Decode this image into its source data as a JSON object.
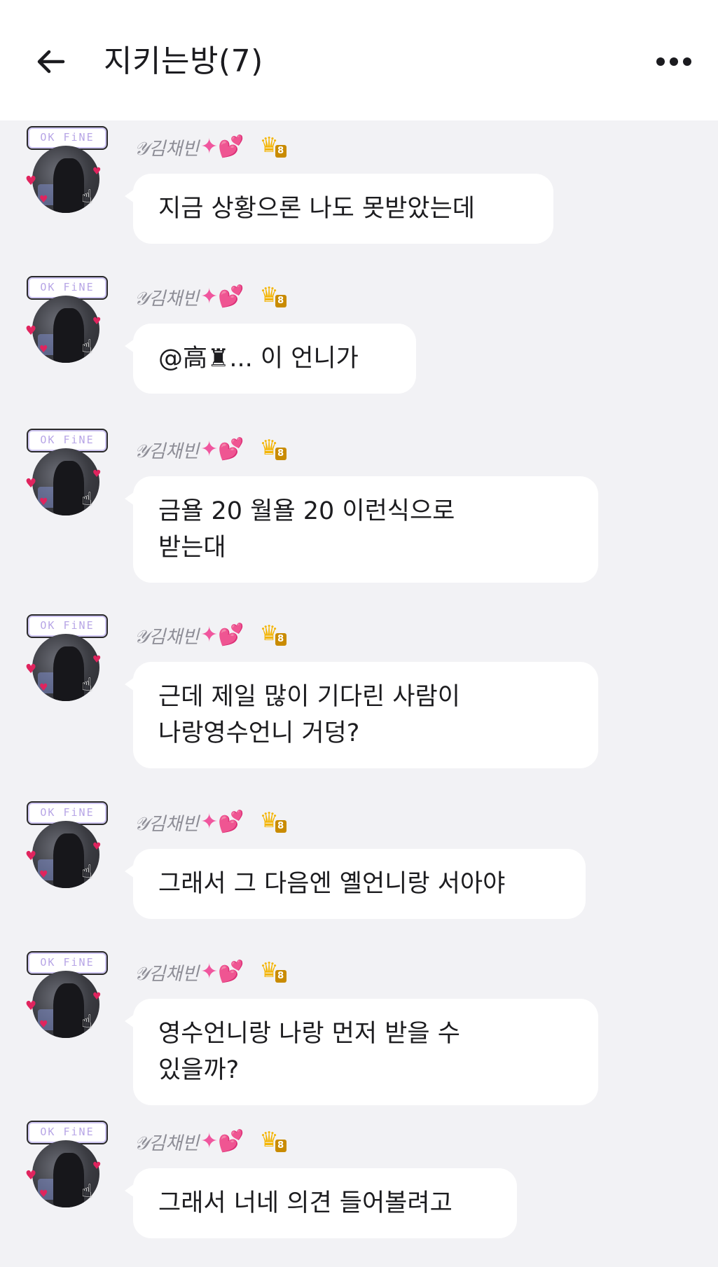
{
  "header": {
    "back_icon": "arrow-left-icon",
    "title": "지키는방(7)",
    "more_icon": "more-horizontal-icon"
  },
  "sender": {
    "name": "𝒴김채빈",
    "badge_text": "OK FiNE",
    "level": "8"
  },
  "messages": [
    {
      "lines": [
        "지금 상황으론 나도 못받았는데"
      ]
    },
    {
      "lines": [
        "@高♜...  이 언니가"
      ]
    },
    {
      "lines": [
        "금욜 20 월욜 20 이런식으로",
        "받는대"
      ]
    },
    {
      "lines": [
        "근데 제일 많이 기다린 사람이",
        "나랑영수언니 거덩?"
      ]
    },
    {
      "lines": [
        "그래서 그 다음엔 옐언니랑 서아야"
      ]
    },
    {
      "lines": [
        "영수언니랑 나랑 먼저 받을 수",
        "있을까?"
      ]
    },
    {
      "lines": [
        "그래서 너네 의견 들어볼려고"
      ]
    }
  ],
  "colors": {
    "background": "#f2f2f5",
    "bubble": "#ffffff",
    "name": "#8d8d96",
    "heart": "#f0569e",
    "crown": "#f4b400"
  }
}
